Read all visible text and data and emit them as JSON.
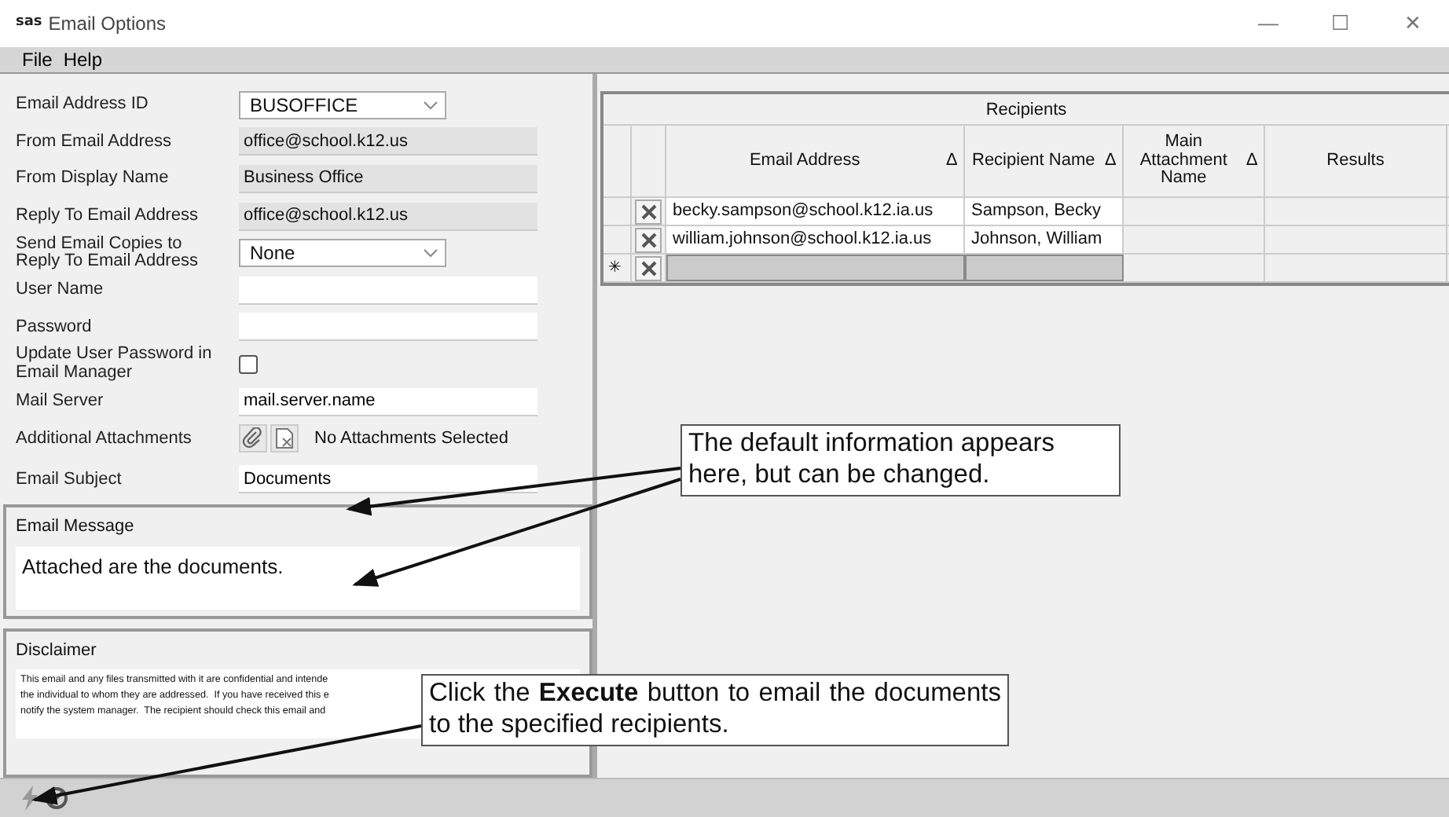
{
  "window": {
    "logo": "sas",
    "title": "Email Options",
    "controls": [
      "—",
      "☐",
      "✕"
    ]
  },
  "menu": [
    "File",
    "Help"
  ],
  "form": {
    "fields": [
      {
        "kind": "combo",
        "label": "Email Address ID",
        "value": "BUSOFFICE"
      },
      {
        "kind": "readonly",
        "label": "From Email Address",
        "value": "office@school.k12.us"
      },
      {
        "kind": "readonly",
        "label": "From Display Name",
        "value": "Business Office"
      },
      {
        "kind": "readonly",
        "label": "Reply To Email Address",
        "value": "office@school.k12.us"
      },
      {
        "kind": "combo",
        "label": "Send Email Copies to Reply To Email Address",
        "value": "None"
      },
      {
        "kind": "text",
        "label": "User Name"
      },
      {
        "kind": "text",
        "label": "Password"
      },
      {
        "kind": "checkbox",
        "label": "Update User Password in Email Manager",
        "checked": false
      },
      {
        "kind": "text",
        "label": "Mail Server",
        "value": "mail.server.name"
      },
      {
        "kind": "attachments",
        "label": "Additional Attachments",
        "value": "No Attachments Selected"
      },
      {
        "kind": "text",
        "label": "Email Subject",
        "value": "Documents"
      }
    ]
  },
  "email_message": {
    "label": "Email Message",
    "value": "Attached are the documents."
  },
  "disclaimer": {
    "label": "Disclaimer",
    "lines": [
      "This email and any files transmitted with it are confidential and intende",
      "the individual to whom they are addressed.  If you have received this e",
      "notify the system manager.  The recipient should check this email and"
    ]
  },
  "recipients": {
    "title": "Recipients",
    "columns": [
      {
        "label": "Email Address",
        "sortable": true
      },
      {
        "label": "Recipient Name",
        "sortable": true
      },
      {
        "label": "Main Attachment Name",
        "sortable": true
      },
      {
        "label": "Results",
        "sortable": false
      }
    ],
    "sort_glyph": "∆",
    "rows": [
      {
        "email": "becky.sampson@school.k12.ia.us",
        "name": "Sampson, Becky",
        "new": false
      },
      {
        "email": "william.johnson@school.k12.ia.us",
        "name": "Johnson, William",
        "new": false
      },
      {
        "marker": "✳",
        "new": true
      }
    ]
  },
  "callouts": [
    {
      "text": "The default information appears here, but can be changed."
    },
    {
      "text": "Click the **Execute** button to email the documents to the specified recipients."
    }
  ]
}
